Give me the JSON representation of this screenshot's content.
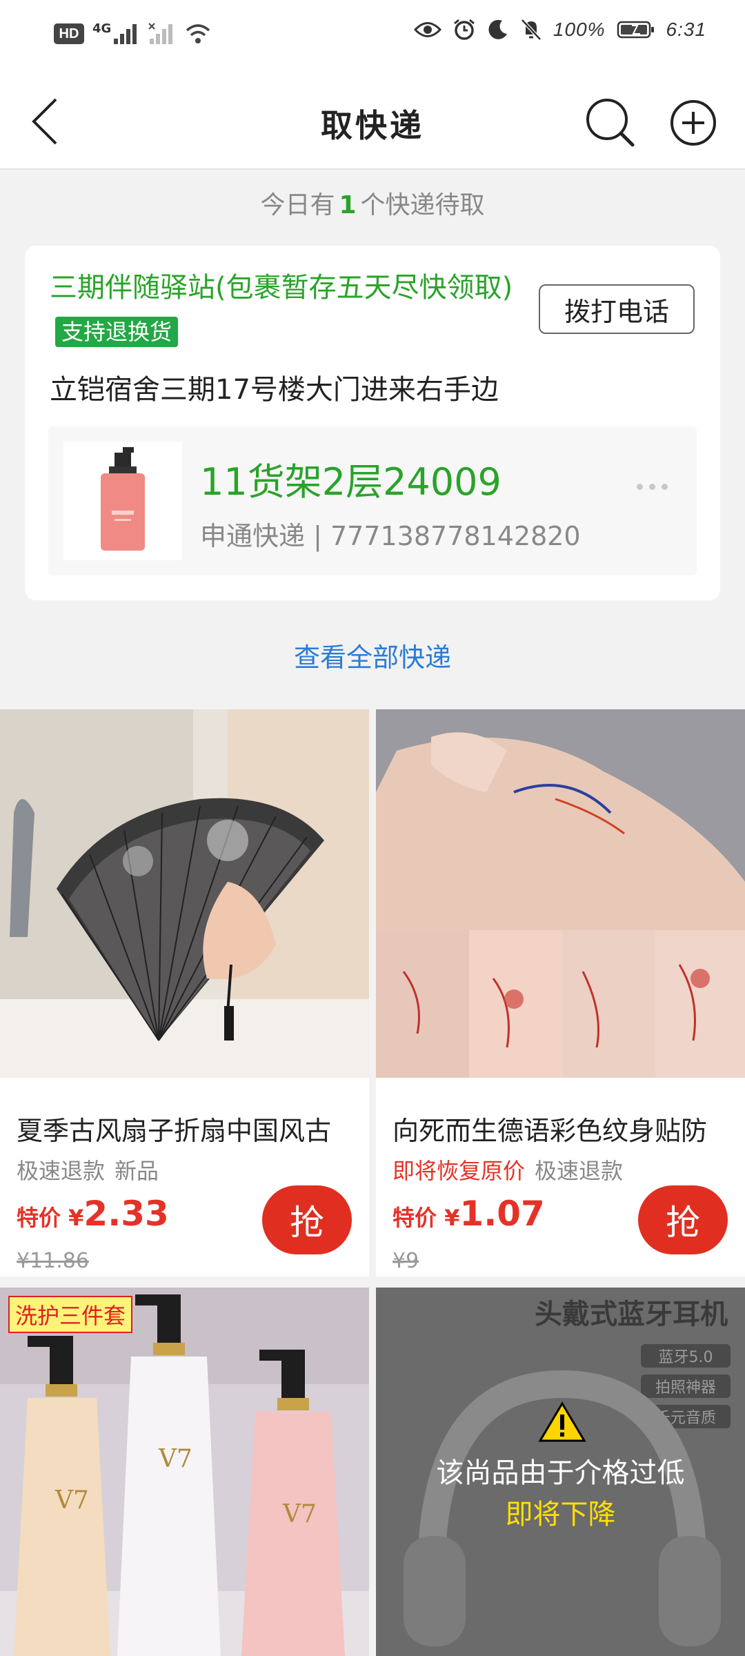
{
  "status_bar": {
    "network_hd": "HD",
    "network_4g": "4G",
    "battery_percent": "100%",
    "time": "6:31"
  },
  "nav": {
    "title": "取快递"
  },
  "summary": {
    "prefix": "今日有",
    "count": "1",
    "suffix": "个快递待取"
  },
  "pickup": {
    "station_name": "三期伴随驿站(包裹暂存五天尽快领取)",
    "station_tag": "支持退换货",
    "call_button": "拨打电话",
    "address": "立铠宿舍三期17号楼大门进来右手边",
    "package": {
      "shelf_code": "11货架2层24009",
      "courier_info": "申通快递 | 777138778142820"
    }
  },
  "view_all": "查看全部快递",
  "products": [
    {
      "name": "夏季古风扇子折扇中国风古",
      "tags": [
        "极速退款",
        "新品"
      ],
      "price_label": "特价 ¥",
      "price": "2.33",
      "original_price": "¥11.86",
      "grab_label": "抢"
    },
    {
      "name": "向死而生德语彩色纹身贴防",
      "tags": [
        "即将恢复原价",
        "极速退款"
      ],
      "price_label": "特价 ¥",
      "price": "1.07",
      "original_price": "¥9",
      "grab_label": "抢"
    },
    {
      "badge": "洗护三件套",
      "image_text": "V7"
    },
    {
      "image_title": "头戴式蓝牙耳机",
      "image_features": [
        "蓝牙5.0",
        "拍照神器",
        "千元音质"
      ],
      "warning_line1": "该尚品由于介格过低",
      "warning_line2": "即将下降"
    }
  ],
  "colors": {
    "green": "#2aa32a",
    "red": "#e53228",
    "link_blue": "#2b7bd6"
  }
}
